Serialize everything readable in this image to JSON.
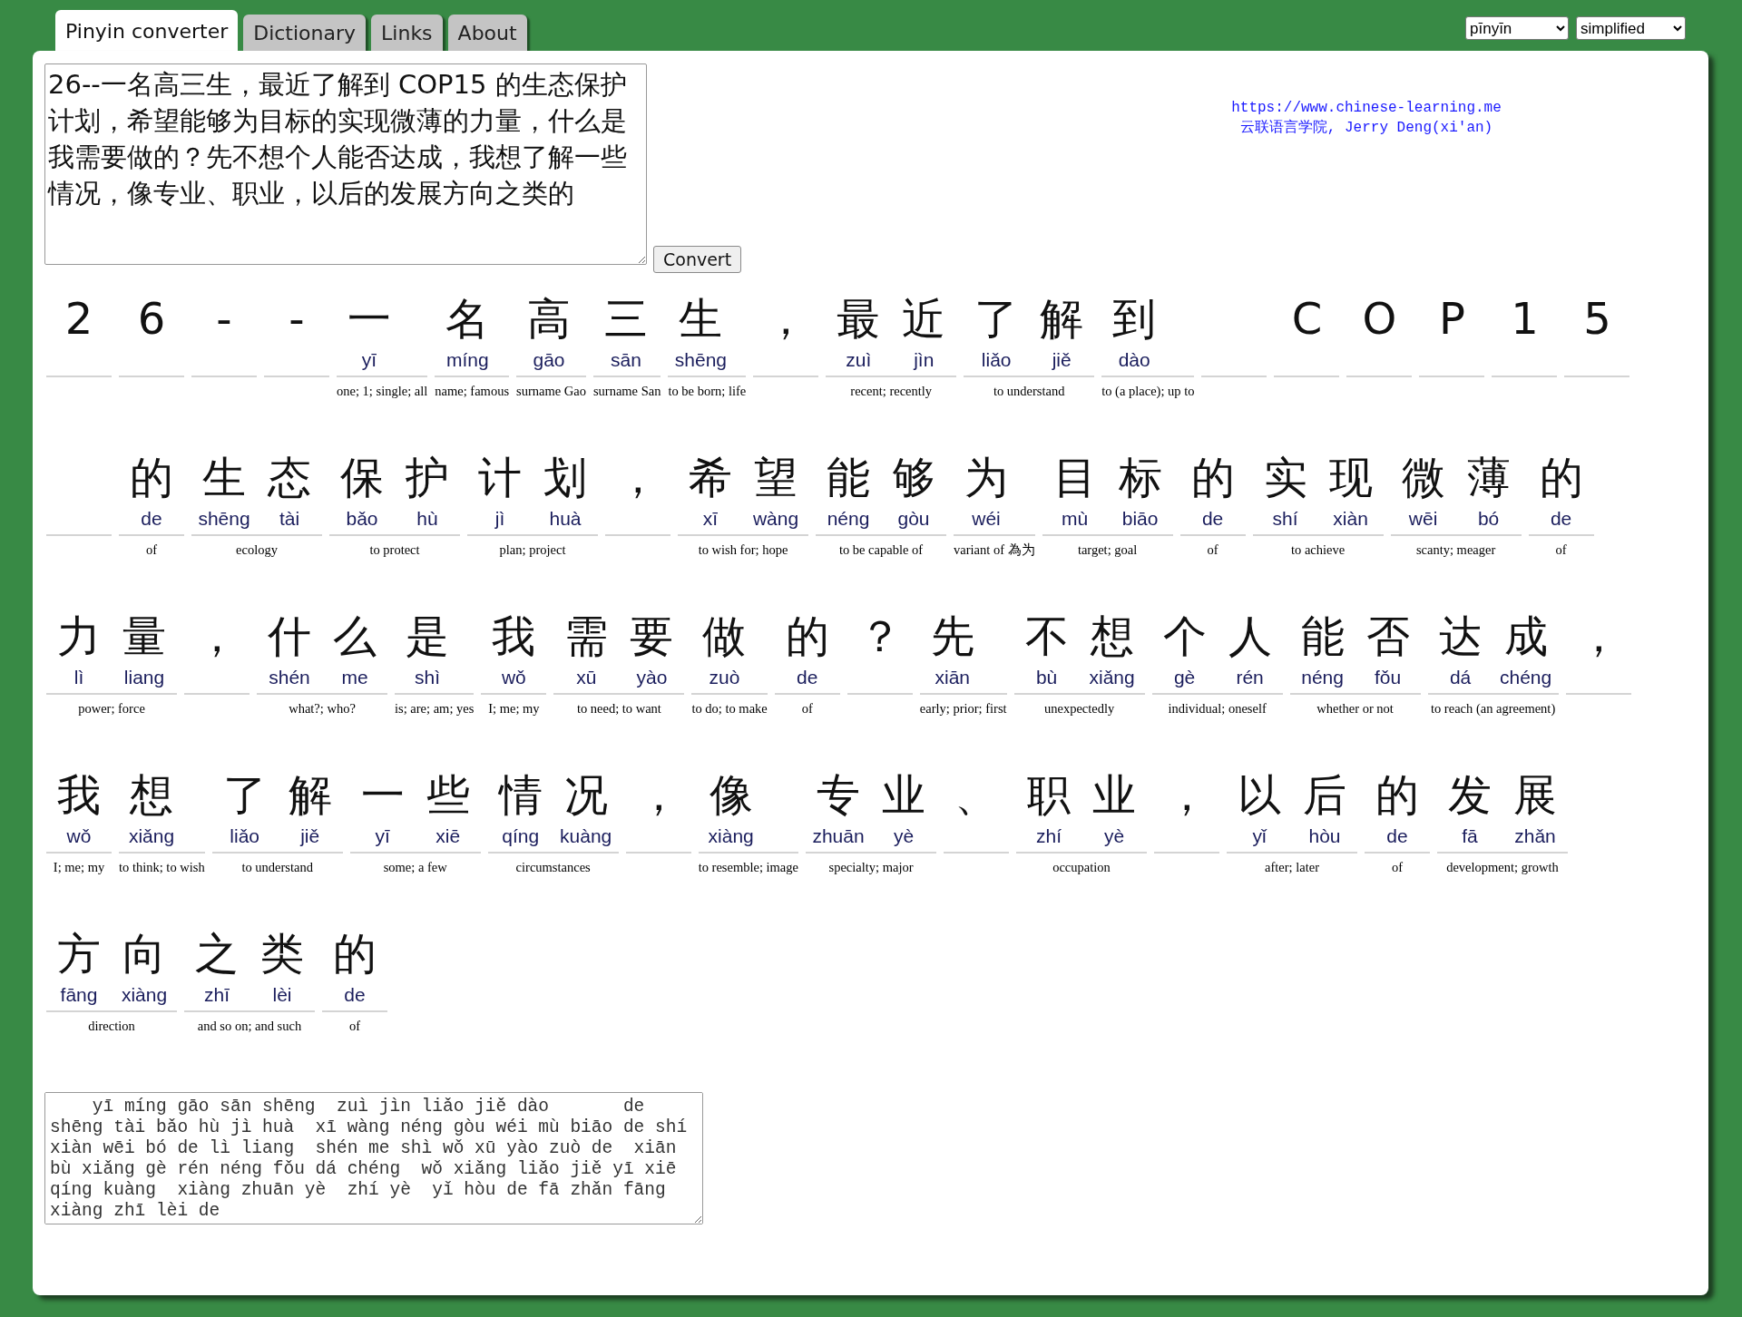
{
  "tabs": [
    {
      "label": "Pinyin converter",
      "selected": true
    },
    {
      "label": "Dictionary",
      "selected": false
    },
    {
      "label": "Links",
      "selected": false
    },
    {
      "label": "About",
      "selected": false
    }
  ],
  "selects": [
    {
      "value": "pīnyīn"
    },
    {
      "value": "simplified"
    }
  ],
  "credit": {
    "link": "https://www.chinese-learning.me",
    "text": "云联语言学院, Jerry Deng(xi'an)"
  },
  "input": {
    "value": "26--一名高三生，最近了解到 COP15 的生态保护计划，希望能够为目标的实现微薄的力量，什么是我需要做的？先不想个人能否达成，我想了解一些情况，像专业、职业，以后的发展方向之类的"
  },
  "convert_button": "Convert",
  "words": [
    {
      "kind": "word",
      "hanzi": [
        "2"
      ]
    },
    {
      "kind": "word",
      "hanzi": [
        "6"
      ]
    },
    {
      "kind": "word",
      "hanzi": [
        "-"
      ]
    },
    {
      "kind": "word",
      "hanzi": [
        "-"
      ]
    },
    {
      "kind": "word",
      "hanzi": [
        "一"
      ],
      "pinyin": [
        "yī"
      ],
      "gloss": "one; 1; single; all"
    },
    {
      "kind": "word",
      "hanzi": [
        "名"
      ],
      "pinyin": [
        "míng"
      ],
      "gloss": "name; famous"
    },
    {
      "kind": "word",
      "hanzi": [
        "高"
      ],
      "pinyin": [
        "gāo"
      ],
      "gloss": "surname Gao"
    },
    {
      "kind": "word",
      "hanzi": [
        "三"
      ],
      "pinyin": [
        "sān"
      ],
      "gloss": "surname San"
    },
    {
      "kind": "word",
      "hanzi": [
        "生"
      ],
      "pinyin": [
        "shēng"
      ],
      "gloss": "to be born; life"
    },
    {
      "kind": "word",
      "hanzi": [
        "，"
      ]
    },
    {
      "kind": "word",
      "hanzi": [
        "最",
        "近"
      ],
      "pinyin": [
        "zuì",
        "jìn"
      ],
      "gloss": "recent; recently"
    },
    {
      "kind": "word",
      "hanzi": [
        "了",
        "解"
      ],
      "pinyin": [
        "liǎo",
        "jiě"
      ],
      "gloss": "to understand"
    },
    {
      "kind": "word",
      "hanzi": [
        "到"
      ],
      "pinyin": [
        "dào"
      ],
      "gloss": "to (a place); up to"
    },
    {
      "kind": "space"
    },
    {
      "kind": "word",
      "hanzi": [
        "C"
      ]
    },
    {
      "kind": "word",
      "hanzi": [
        "O"
      ]
    },
    {
      "kind": "word",
      "hanzi": [
        "P"
      ]
    },
    {
      "kind": "word",
      "hanzi": [
        "1"
      ]
    },
    {
      "kind": "word",
      "hanzi": [
        "5"
      ]
    },
    {
      "kind": "space"
    },
    {
      "kind": "word",
      "hanzi": [
        "的"
      ],
      "pinyin": [
        "de"
      ],
      "gloss": "of"
    },
    {
      "kind": "word",
      "hanzi": [
        "生",
        "态"
      ],
      "pinyin": [
        "shēng",
        "tài"
      ],
      "gloss": "ecology"
    },
    {
      "kind": "word",
      "hanzi": [
        "保",
        "护"
      ],
      "pinyin": [
        "bǎo",
        "hù"
      ],
      "gloss": "to protect"
    },
    {
      "kind": "word",
      "hanzi": [
        "计",
        "划"
      ],
      "pinyin": [
        "jì",
        "huà"
      ],
      "gloss": "plan; project"
    },
    {
      "kind": "word",
      "hanzi": [
        "，"
      ]
    },
    {
      "kind": "word",
      "hanzi": [
        "希",
        "望"
      ],
      "pinyin": [
        "xī",
        "wàng"
      ],
      "gloss": "to wish for; hope"
    },
    {
      "kind": "word",
      "hanzi": [
        "能",
        "够"
      ],
      "pinyin": [
        "néng",
        "gòu"
      ],
      "gloss": "to be capable of"
    },
    {
      "kind": "word",
      "hanzi": [
        "为"
      ],
      "pinyin": [
        "wéi"
      ],
      "gloss": "variant of 為为"
    },
    {
      "kind": "word",
      "hanzi": [
        "目",
        "标"
      ],
      "pinyin": [
        "mù",
        "biāo"
      ],
      "gloss": "target; goal"
    },
    {
      "kind": "word",
      "hanzi": [
        "的"
      ],
      "pinyin": [
        "de"
      ],
      "gloss": "of"
    },
    {
      "kind": "word",
      "hanzi": [
        "实",
        "现"
      ],
      "pinyin": [
        "shí",
        "xiàn"
      ],
      "gloss": "to achieve"
    },
    {
      "kind": "word",
      "hanzi": [
        "微",
        "薄"
      ],
      "pinyin": [
        "wēi",
        "bó"
      ],
      "gloss": "scanty; meager"
    },
    {
      "kind": "word",
      "hanzi": [
        "的"
      ],
      "pinyin": [
        "de"
      ],
      "gloss": "of"
    },
    {
      "kind": "word",
      "hanzi": [
        "力",
        "量"
      ],
      "pinyin": [
        "lì",
        "liang"
      ],
      "gloss": "power; force"
    },
    {
      "kind": "word",
      "hanzi": [
        "，"
      ]
    },
    {
      "kind": "word",
      "hanzi": [
        "什",
        "么"
      ],
      "pinyin": [
        "shén",
        "me"
      ],
      "gloss": "what?; who?"
    },
    {
      "kind": "word",
      "hanzi": [
        "是"
      ],
      "pinyin": [
        "shì"
      ],
      "gloss": "is; are; am; yes"
    },
    {
      "kind": "word",
      "hanzi": [
        "我"
      ],
      "pinyin": [
        "wǒ"
      ],
      "gloss": "I; me; my"
    },
    {
      "kind": "word",
      "hanzi": [
        "需",
        "要"
      ],
      "pinyin": [
        "xū",
        "yào"
      ],
      "gloss": "to need; to want"
    },
    {
      "kind": "word",
      "hanzi": [
        "做"
      ],
      "pinyin": [
        "zuò"
      ],
      "gloss": "to do; to make"
    },
    {
      "kind": "word",
      "hanzi": [
        "的"
      ],
      "pinyin": [
        "de"
      ],
      "gloss": "of"
    },
    {
      "kind": "word",
      "hanzi": [
        "？"
      ]
    },
    {
      "kind": "word",
      "hanzi": [
        "先"
      ],
      "pinyin": [
        "xiān"
      ],
      "gloss": "early; prior; first"
    },
    {
      "kind": "word",
      "hanzi": [
        "不",
        "想"
      ],
      "pinyin": [
        "bù",
        "xiǎng"
      ],
      "gloss": "unexpectedly"
    },
    {
      "kind": "word",
      "hanzi": [
        "个",
        "人"
      ],
      "pinyin": [
        "gè",
        "rén"
      ],
      "gloss": "individual; oneself"
    },
    {
      "kind": "word",
      "hanzi": [
        "能",
        "否"
      ],
      "pinyin": [
        "néng",
        "fǒu"
      ],
      "gloss": "whether or not"
    },
    {
      "kind": "word",
      "hanzi": [
        "达",
        "成"
      ],
      "pinyin": [
        "dá",
        "chéng"
      ],
      "gloss": "to reach (an agreement)"
    },
    {
      "kind": "word",
      "hanzi": [
        "，"
      ]
    },
    {
      "kind": "word",
      "hanzi": [
        "我"
      ],
      "pinyin": [
        "wǒ"
      ],
      "gloss": "I; me; my"
    },
    {
      "kind": "word",
      "hanzi": [
        "想"
      ],
      "pinyin": [
        "xiǎng"
      ],
      "gloss": "to think; to wish"
    },
    {
      "kind": "word",
      "hanzi": [
        "了",
        "解"
      ],
      "pinyin": [
        "liǎo",
        "jiě"
      ],
      "gloss": "to understand"
    },
    {
      "kind": "word",
      "hanzi": [
        "一",
        "些"
      ],
      "pinyin": [
        "yī",
        "xiē"
      ],
      "gloss": "some; a few"
    },
    {
      "kind": "word",
      "hanzi": [
        "情",
        "况"
      ],
      "pinyin": [
        "qíng",
        "kuàng"
      ],
      "gloss": "circumstances"
    },
    {
      "kind": "word",
      "hanzi": [
        "，"
      ]
    },
    {
      "kind": "word",
      "hanzi": [
        "像"
      ],
      "pinyin": [
        "xiàng"
      ],
      "gloss": "to resemble; image"
    },
    {
      "kind": "word",
      "hanzi": [
        "专",
        "业"
      ],
      "pinyin": [
        "zhuān",
        "yè"
      ],
      "gloss": "specialty; major"
    },
    {
      "kind": "word",
      "hanzi": [
        "、"
      ]
    },
    {
      "kind": "word",
      "hanzi": [
        "职",
        "业"
      ],
      "pinyin": [
        "zhí",
        "yè"
      ],
      "gloss": "occupation"
    },
    {
      "kind": "word",
      "hanzi": [
        "，"
      ]
    },
    {
      "kind": "word",
      "hanzi": [
        "以",
        "后"
      ],
      "pinyin": [
        "yǐ",
        "hòu"
      ],
      "gloss": "after; later"
    },
    {
      "kind": "word",
      "hanzi": [
        "的"
      ],
      "pinyin": [
        "de"
      ],
      "gloss": "of"
    },
    {
      "kind": "word",
      "hanzi": [
        "发",
        "展"
      ],
      "pinyin": [
        "fā",
        "zhǎn"
      ],
      "gloss": "development; growth"
    },
    {
      "kind": "word",
      "hanzi": [
        "方",
        "向"
      ],
      "pinyin": [
        "fāng",
        "xiàng"
      ],
      "gloss": "direction"
    },
    {
      "kind": "word",
      "hanzi": [
        "之",
        "类"
      ],
      "pinyin": [
        "zhī",
        "lèi"
      ],
      "gloss": "and so on; and such"
    },
    {
      "kind": "word",
      "hanzi": [
        "的"
      ],
      "pinyin": [
        "de"
      ],
      "gloss": "of"
    }
  ],
  "output": {
    "value": "    yī míng gāo sān shēng  zuì jìn liǎo jiě dào       de shēng tài bǎo hù jì huà  xī wàng néng gòu wéi mù biāo de shí xiàn wēi bó de lì liang  shén me shì wǒ xū yào zuò de  xiān bù xiǎng gè rén néng fǒu dá chéng  wǒ xiǎng liǎo jiě yī xiē qíng kuàng  xiàng zhuān yè  zhí yè  yǐ hòu de fā zhǎn fāng xiàng zhī lèi de"
  }
}
